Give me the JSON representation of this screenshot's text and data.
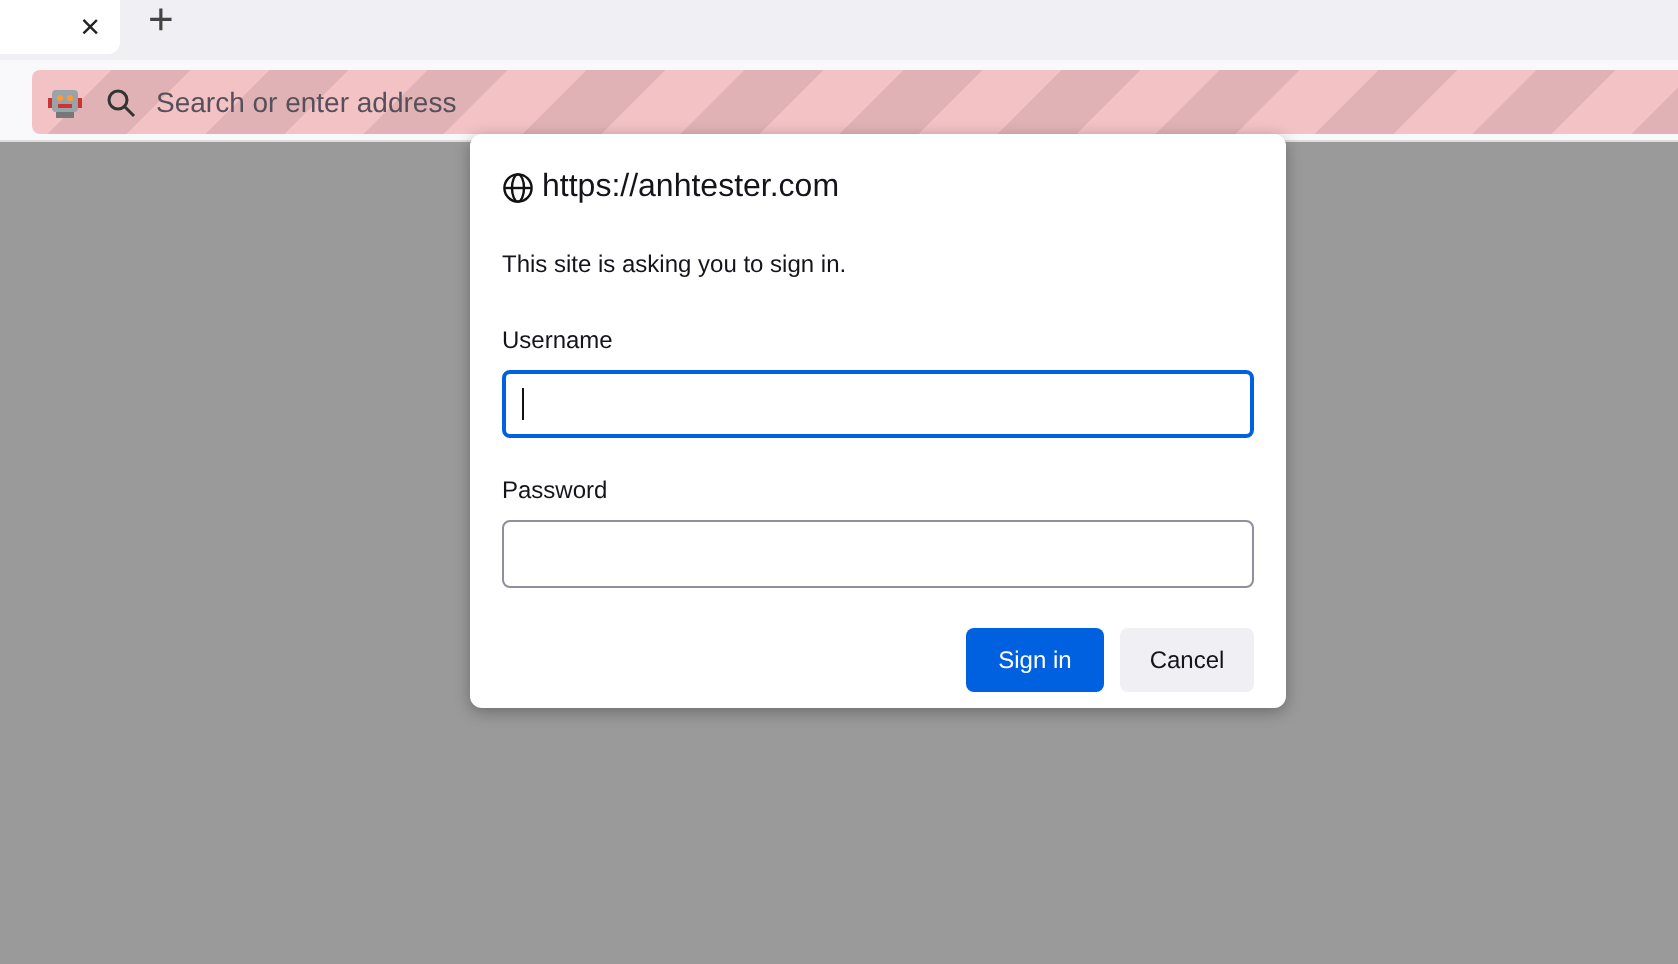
{
  "tabs": [
    {
      "close": "×",
      "selected": true
    }
  ],
  "new_tab": "+",
  "address_bar": {
    "placeholder": "Search or enter address"
  },
  "dialog": {
    "origin": "https://anhtester.com",
    "message": "This site is asking you to sign in.",
    "fields": [
      {
        "label": "Username",
        "focused": true
      },
      {
        "label": "Password",
        "focused": false
      }
    ],
    "buttons": [
      {
        "label": "Sign in",
        "kind": "primary"
      },
      {
        "label": "Cancel",
        "kind": "secondary"
      }
    ]
  }
}
